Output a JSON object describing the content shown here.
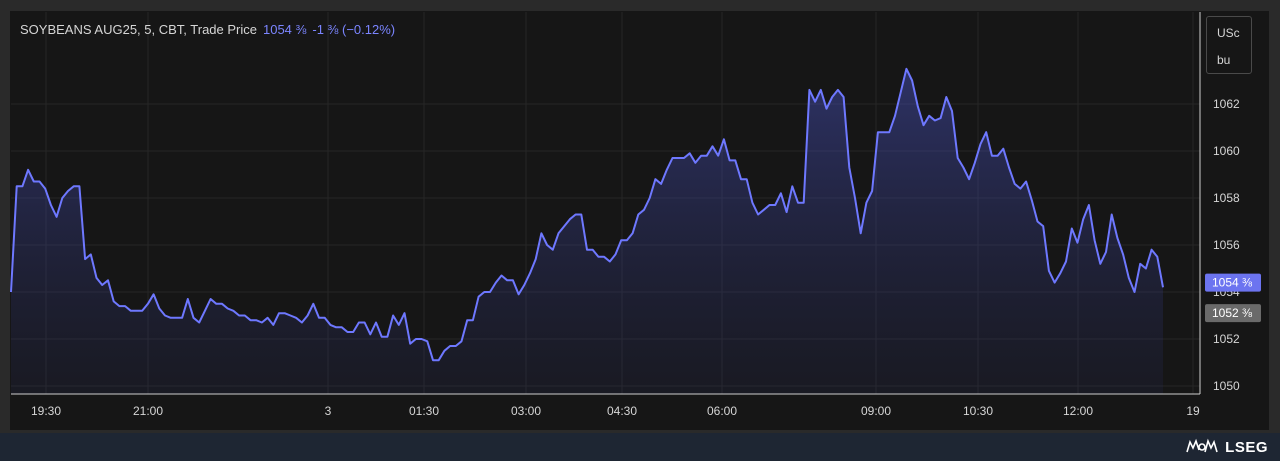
{
  "header": {
    "title": "SOYBEANS AUG25, 5, CBT, Trade Price",
    "last_price": "1054 ⅜",
    "change": "-1 ⅜ (−0.12%)"
  },
  "unit": {
    "top": "USc",
    "bottom": "bu"
  },
  "brand": {
    "name": "LSEG"
  },
  "colors": {
    "line": "#6e78ff",
    "price_tag": "#6c74f0",
    "grey_tag": "#6a6a6a"
  },
  "chart_data": {
    "type": "area",
    "title": "SOYBEANS AUG25, 5, CBT, Trade Price",
    "xlabel": "",
    "ylabel": "",
    "ylim": [
      1050,
      1063.5
    ],
    "grid": true,
    "x_ticks": [
      "19:30",
      "21:00",
      "3",
      "01:30",
      "03:00",
      "04:30",
      "06:00",
      "09:00",
      "10:30",
      "12:00",
      "19"
    ],
    "y_ticks": [
      1050,
      1052,
      1054,
      1056,
      1058,
      1060,
      1062
    ],
    "price_tags": [
      {
        "label": "1054 ⅜",
        "value": 1054.4,
        "style": "accent"
      },
      {
        "label": "1052 ⅜",
        "value": 1053.1,
        "style": "grey"
      }
    ],
    "series": [
      {
        "values": [
          1054,
          1058.5,
          1058.5,
          1059.2,
          1058.7,
          1058.7,
          1058.4,
          1057.7,
          1057.2,
          1058,
          1058.3,
          1058.5,
          1058.5,
          1055.4,
          1055.6,
          1054.6,
          1054.3,
          1054.5,
          1053.6,
          1053.4,
          1053.4,
          1053.2,
          1053.2,
          1053.2,
          1053.5,
          1053.9,
          1053.3,
          1053,
          1052.9,
          1052.9,
          1052.9,
          1053.7,
          1052.9,
          1052.7,
          1053.2,
          1053.7,
          1053.5,
          1053.5,
          1053.3,
          1053.2,
          1053,
          1053,
          1052.8,
          1052.8,
          1052.7,
          1052.9,
          1052.6,
          1053.1,
          1053.1,
          1053,
          1052.9,
          1052.7,
          1053,
          1053.5,
          1052.9,
          1052.9,
          1052.6,
          1052.5,
          1052.5,
          1052.3,
          1052.3,
          1052.7,
          1052.7,
          1052.2,
          1052.7,
          1052.1,
          1052.1,
          1053,
          1052.6,
          1053.1,
          1051.8,
          1052,
          1052,
          1051.9,
          1051.1,
          1051.1,
          1051.5,
          1051.7,
          1051.7,
          1051.9,
          1052.8,
          1052.8,
          1053.8,
          1054,
          1054,
          1054.4,
          1054.7,
          1054.5,
          1054.5,
          1053.9,
          1054.3,
          1054.8,
          1055.4,
          1056.5,
          1056,
          1055.8,
          1056.5,
          1056.8,
          1057.1,
          1057.3,
          1057.3,
          1055.8,
          1055.8,
          1055.5,
          1055.5,
          1055.3,
          1055.6,
          1056.2,
          1056.2,
          1056.5,
          1057.3,
          1057.5,
          1058,
          1058.8,
          1058.6,
          1059.2,
          1059.7,
          1059.7,
          1059.7,
          1059.9,
          1059.5,
          1059.8,
          1059.8,
          1060.2,
          1059.8,
          1060.5,
          1059.6,
          1059.6,
          1058.8,
          1058.8,
          1057.8,
          1057.3,
          1057.5,
          1057.7,
          1057.7,
          1058.2,
          1057.4,
          1058.5,
          1057.8,
          1057.8,
          1062.6,
          1062.1,
          1062.6,
          1061.8,
          1062.3,
          1062.6,
          1062.3,
          1059.3,
          1058,
          1056.5,
          1057.8,
          1058.3,
          1060.8,
          1060.8,
          1060.8,
          1061.5,
          1062.5,
          1063.5,
          1063,
          1061.9,
          1061.1,
          1061.5,
          1061.3,
          1061.4,
          1062.3,
          1061.7,
          1059.7,
          1059.3,
          1058.8,
          1059.5,
          1060.3,
          1060.8,
          1059.8,
          1059.8,
          1060.1,
          1059.3,
          1058.6,
          1058.4,
          1058.7,
          1057.9,
          1057,
          1056.8,
          1054.9,
          1054.4,
          1054.8,
          1055.3,
          1056.7,
          1056.1,
          1057.1,
          1057.7,
          1056.2,
          1055.2,
          1055.7,
          1057.3,
          1056.3,
          1055.6,
          1054.6,
          1054,
          1055.2,
          1055,
          1055.8,
          1055.5,
          1054.2
        ]
      }
    ]
  }
}
